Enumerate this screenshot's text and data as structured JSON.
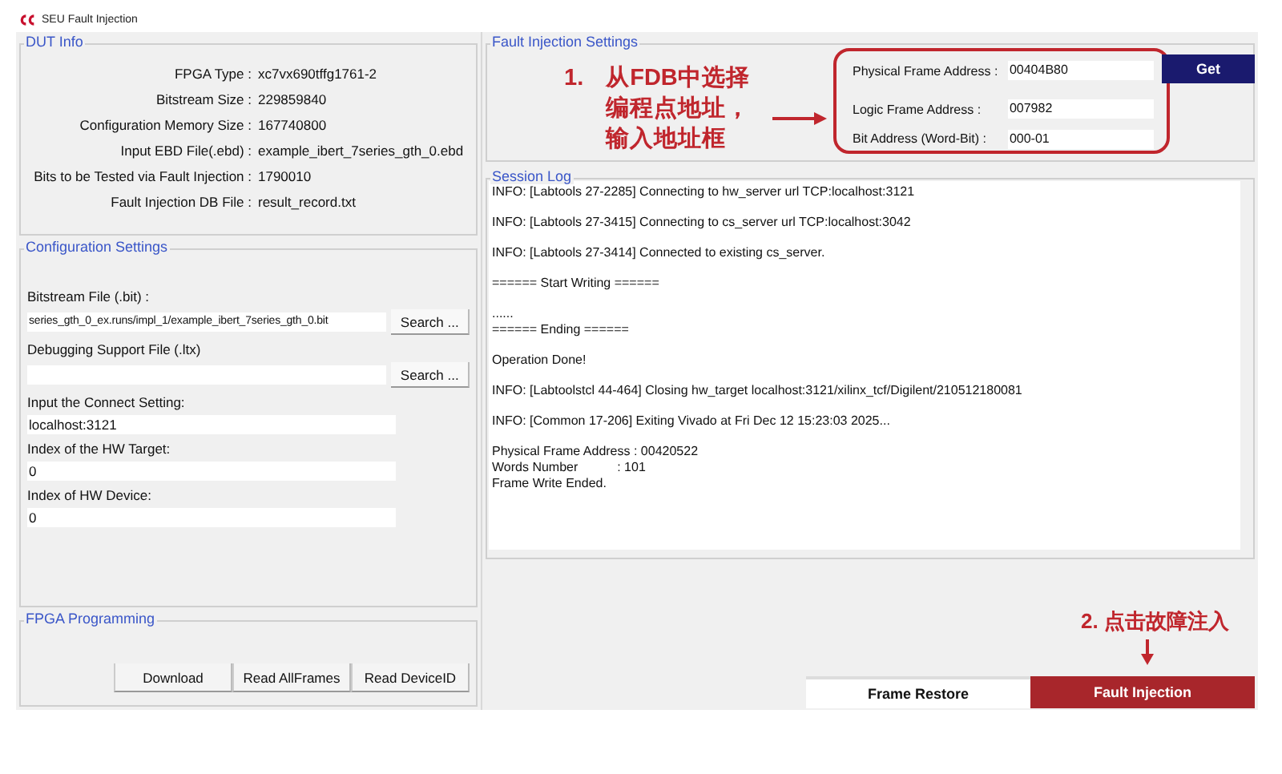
{
  "window": {
    "title": "SEU Fault Injection"
  },
  "dut_info": {
    "title": "DUT Info",
    "rows": [
      {
        "label": "FPGA Type :",
        "value": "xc7vx690tffg1761-2"
      },
      {
        "label": "Bitstream Size :",
        "value": "229859840"
      },
      {
        "label": "Configuration Memory Size :",
        "value": "167740800"
      },
      {
        "label": "Input EBD File(.ebd) :",
        "value": "example_ibert_7series_gth_0.ebd"
      },
      {
        "label": "Bits to be Tested via Fault Injection :",
        "value": "1790010"
      },
      {
        "label": "Fault Injection DB File :",
        "value": "result_record.txt"
      }
    ]
  },
  "configuration": {
    "title": "Configuration Settings",
    "fields": [
      {
        "label": "Bitstream File (.bit) :",
        "value": "series_gth_0_ex.runs/impl_1/example_ibert_7series_gth_0.bit",
        "button": "Search ..."
      },
      {
        "label": "Debugging Support File (.ltx)",
        "button": "Search ..."
      },
      {
        "label": "Input the Connect Setting:",
        "value": "localhost:3121"
      },
      {
        "label": "Index of the HW Target:",
        "value": "0"
      },
      {
        "label": "Index of HW Device:",
        "value": "0"
      }
    ]
  },
  "fpga_programming": {
    "title": "FPGA Programming",
    "buttons": [
      "Download",
      "Read AllFrames",
      "Read DeviceID"
    ]
  },
  "fault_injection_settings": {
    "title": "Fault Injection Settings",
    "fields": [
      {
        "label": "Physical Frame Address :",
        "value": "00404B80"
      },
      {
        "label": "Logic Frame Address :",
        "value": "007982"
      },
      {
        "label": "Bit Address (Word-Bit) :",
        "value": "000-01"
      }
    ],
    "get_button": "Get",
    "annotation": {
      "number": "1.",
      "lines": [
        "从FDB中选择",
        "编程点地址，",
        "输入地址框"
      ]
    }
  },
  "session_log": {
    "title": "Session Log",
    "paragraphs": [
      [
        "INFO: [Labtools 27-2285] Connecting to hw_server url TCP:localhost:3121"
      ],
      [
        "INFO: [Labtools 27-3415] Connecting to cs_server url TCP:localhost:3042"
      ],
      [
        "INFO: [Labtools 27-3414] Connected to existing cs_server."
      ],
      [
        "====== Start Writing ======"
      ],
      [
        "......",
        "====== Ending ======"
      ],
      [
        "Operation Done!"
      ],
      [
        "INFO: [Labtoolstcl 44-464] Closing hw_target localhost:3121/xilinx_tcf/Digilent/210512180081"
      ],
      [
        "INFO: [Common 17-206] Exiting Vivado at Fri Dec 12 15:23:03 2025..."
      ],
      [
        "Physical Frame Address : 00420522",
        "Words Number           : 101",
        "Frame Write Ended."
      ]
    ]
  },
  "actions": {
    "annotation": "2. 点击故障注入",
    "buttons": [
      {
        "label": "Frame Restore",
        "kind": "plain"
      },
      {
        "label": "Fault Injection",
        "kind": "primary"
      }
    ]
  }
}
